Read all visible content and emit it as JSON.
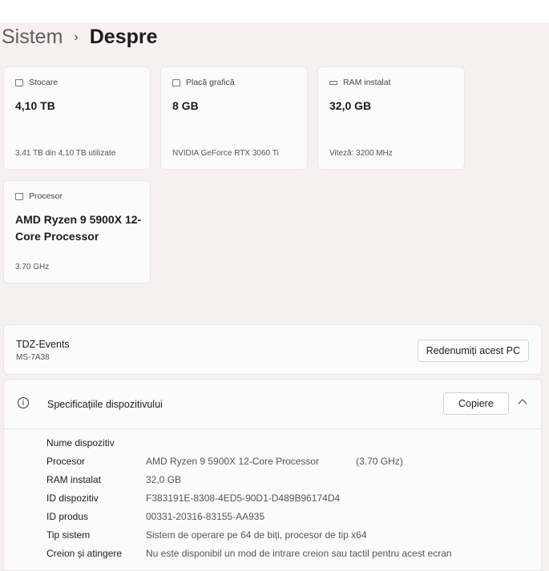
{
  "breadcrumb": {
    "parent": "Sistem",
    "separator": "›",
    "current": "Despre"
  },
  "cards": [
    {
      "icon": "hard-drive-icon",
      "label": "Stocare",
      "value": "4,10 TB",
      "detail": "3,41 TB din 4,10 TB utilizate"
    },
    {
      "icon": "gpu-icon",
      "label": "Placă grafică",
      "value": "8 GB",
      "detail": "NVIDIA GeForce RTX 3060 Ti"
    },
    {
      "icon": "ram-icon",
      "label": "RAM instalat",
      "value": "32,0 GB",
      "detail": "Viteză: 3200 MHz"
    },
    {
      "icon": "cpu-icon",
      "label": "Procesor",
      "value": "AMD Ryzen 9 5900X 12-Core Processor",
      "detail": "3.70 GHz"
    }
  ],
  "device": {
    "name": "TDZ-Events",
    "model": "MS-7A38",
    "rename_label": "Redenumiți acest PC"
  },
  "specs": {
    "title": "Specificațiile dispozitivului",
    "copy_label": "Copiere",
    "rows": [
      {
        "key": "Nume dispozitiv",
        "value": ""
      },
      {
        "key": "Procesor",
        "value": "AMD Ryzen 9 5900X 12-Core Processor",
        "extra": "(3.70 GHz)"
      },
      {
        "key": "RAM instalat",
        "value": "32,0 GB"
      },
      {
        "key": "ID dispozitiv",
        "value": "F383191E-8308-4ED5-90D1-D489B96174D4"
      },
      {
        "key": "ID produs",
        "value": "00331-20316-83155-AA935"
      },
      {
        "key": "Tip sistem",
        "value": "Sistem de operare pe 64 de biți, procesor de tip x64"
      },
      {
        "key": "Creion și atingere",
        "value": "Nu este disponibil un mod de intrare creion sau tactil pentru acest ecran"
      }
    ]
  }
}
